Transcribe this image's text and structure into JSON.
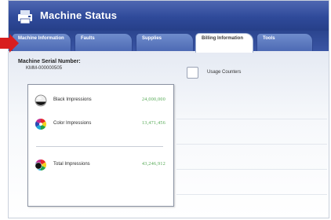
{
  "window": {
    "title": "Machine Status"
  },
  "tabs": [
    {
      "label": "Machine Information",
      "active": false
    },
    {
      "label": "Faults",
      "active": false
    },
    {
      "label": "Supplies",
      "active": false
    },
    {
      "label": "Billing Information",
      "active": true
    },
    {
      "label": "Tools",
      "active": false
    }
  ],
  "machine": {
    "serial_label": "Machine Serial Number:",
    "serial_value": "KMM-000000505"
  },
  "usage_counters": {
    "label": "Usage Counters",
    "checked": false
  },
  "impressions": {
    "black": {
      "label": "Black Impressions",
      "value": "24,000,000"
    },
    "color": {
      "label": "Color Impressions",
      "value": "13,471,456"
    },
    "total": {
      "label": "Total Impressions",
      "value": "43,246,912"
    }
  },
  "colors": {
    "titlebar": "#2f4a9a",
    "tab": "#4c69b3",
    "value_text": "#4fa64f",
    "pointer_arrow": "#d81e1e"
  },
  "icons": {
    "app": "printer-icon",
    "black": "black-toner-icon",
    "color": "color-wheel-icon",
    "total": "total-impressions-icon"
  }
}
